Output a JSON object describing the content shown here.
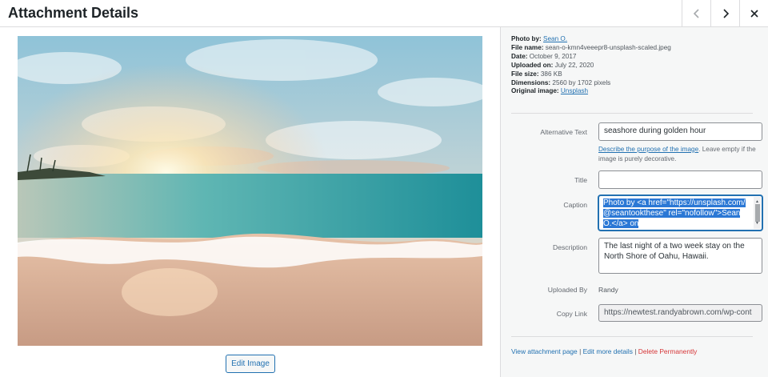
{
  "header": {
    "title": "Attachment Details",
    "prev_icon": "chevron-left-icon",
    "next_icon": "chevron-right-icon",
    "close_icon": "close-icon"
  },
  "image": {
    "alt": "seashore during golden hour",
    "edit_label": "Edit Image"
  },
  "meta": {
    "photo_by_label": "Photo by:",
    "photo_by_value": "Sean O.",
    "file_name_label": "File name:",
    "file_name_value": "sean-o-kmn4veeepr8-unsplash-scaled.jpeg",
    "date_label": "Date:",
    "date_value": "October 9, 2017",
    "uploaded_on_label": "Uploaded on:",
    "uploaded_on_value": "July 22, 2020",
    "file_size_label": "File size:",
    "file_size_value": "386 KB",
    "dimensions_label": "Dimensions:",
    "dimensions_value": "2560 by 1702 pixels",
    "original_label": "Original image:",
    "original_value": "Unsplash"
  },
  "form": {
    "alt_label": "Alternative Text",
    "alt_value": "seashore during golden hour",
    "alt_help_link": "Describe the purpose of the image",
    "alt_help_text": ". Leave empty if the image is purely decorative.",
    "title_label": "Title",
    "title_value": "",
    "caption_label": "Caption",
    "caption_value": "Photo by <a href=\"https://unsplash.com/@seantookthese\" rel=\"nofollow\">Sean O.</a> on",
    "description_label": "Description",
    "description_value": "The last night of a two week stay on the North Shore of Oahu, Hawaii.",
    "uploaded_by_label": "Uploaded By",
    "uploaded_by_value": "Randy",
    "copy_link_label": "Copy Link",
    "copy_link_value": "https://newtest.randyabrown.com/wp-cont"
  },
  "actions": {
    "view": "View attachment page",
    "edit": "Edit more details",
    "delete": "Delete Permanently",
    "separator": "|"
  },
  "colors": {
    "link": "#2271b1",
    "danger": "#d63638",
    "panel_bg": "#f6f7f7"
  }
}
